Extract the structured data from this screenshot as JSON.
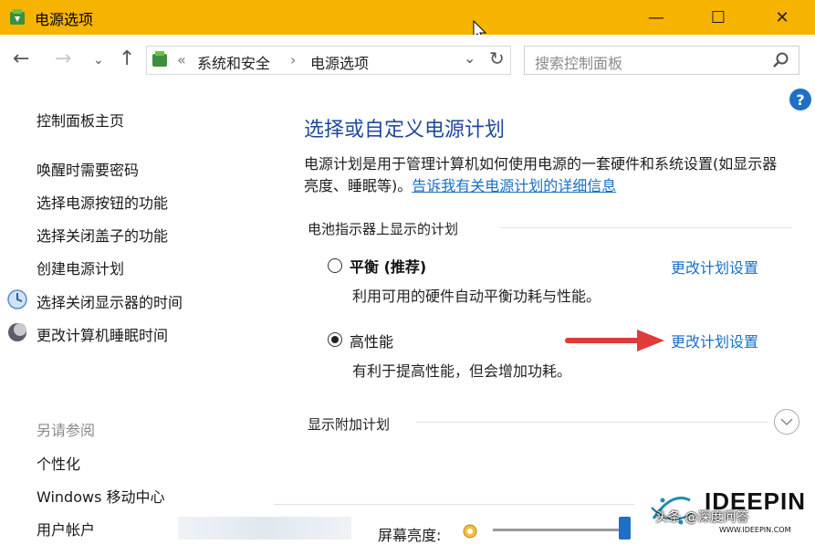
{
  "window": {
    "title": "电源选项",
    "minimize": "—",
    "maximize": "☐",
    "close": "✕"
  },
  "nav": {
    "breadcrumb_sep0": "«",
    "breadcrumb": [
      "系统和安全",
      "电源选项"
    ],
    "breadcrumb_sep": "›",
    "search_placeholder": "搜索控制面板"
  },
  "left": {
    "home": "控制面板主页",
    "links": [
      "唤醒时需要密码",
      "选择电源按钮的功能",
      "选择关闭盖子的功能",
      "创建电源计划",
      "选择关闭显示器的时间",
      "更改计算机睡眠时间"
    ],
    "see_also": "另请参阅",
    "see_also_links": [
      "个性化",
      "Windows 移动中心",
      "用户帐户"
    ]
  },
  "main": {
    "title": "选择或自定义电源计划",
    "desc": "电源计划是用于管理计算机如何使用电源的一套硬件和系统设置(如显示器亮度、睡眠等)。",
    "desc_link": "告诉我有关电源计划的详细信息",
    "section_label": "电池指示器上显示的计划",
    "plans": [
      {
        "name": "平衡 (推荐)",
        "desc": "利用可用的硬件自动平衡功耗与性能。",
        "link": "更改计划设置",
        "selected": false
      },
      {
        "name": "高性能",
        "desc": "有利于提高性能，但会增加功耗。",
        "link": "更改计划设置",
        "selected": true
      }
    ],
    "show_more": "显示附加计划",
    "brightness_label": "屏幕亮度:"
  },
  "watermark": {
    "brand": "IDEEPIN",
    "caption": "头条 @深度问答",
    "site": "WWW.IDEEPIN.COM"
  },
  "colors": {
    "titlebar": "#f6b400",
    "link": "#1a6fc5",
    "title": "#1e4a9c",
    "arrow": "#e03a3a"
  }
}
